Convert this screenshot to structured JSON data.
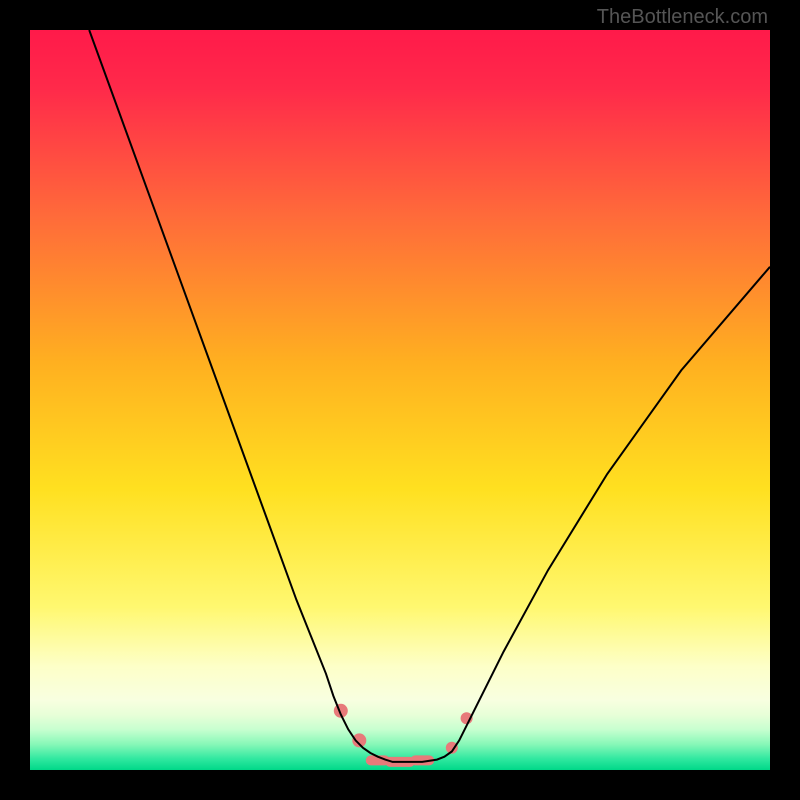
{
  "watermark": "TheBottleneck.com",
  "chart_data": {
    "type": "line",
    "title": "",
    "xlabel": "",
    "ylabel": "",
    "xlim": [
      0,
      100
    ],
    "ylim": [
      0,
      100
    ],
    "background_gradient": {
      "stops": [
        {
          "offset": 0.0,
          "color": "#ff1a4a"
        },
        {
          "offset": 0.08,
          "color": "#ff2a4a"
        },
        {
          "offset": 0.25,
          "color": "#ff6a3a"
        },
        {
          "offset": 0.45,
          "color": "#ffb020"
        },
        {
          "offset": 0.62,
          "color": "#ffe020"
        },
        {
          "offset": 0.78,
          "color": "#fff870"
        },
        {
          "offset": 0.86,
          "color": "#fdffc8"
        },
        {
          "offset": 0.905,
          "color": "#f8ffe0"
        },
        {
          "offset": 0.925,
          "color": "#e8ffd8"
        },
        {
          "offset": 0.945,
          "color": "#c8ffd0"
        },
        {
          "offset": 0.965,
          "color": "#88f8b8"
        },
        {
          "offset": 0.985,
          "color": "#30e8a0"
        },
        {
          "offset": 1.0,
          "color": "#00d888"
        }
      ]
    },
    "series": [
      {
        "name": "bottleneck-curve",
        "color": "#000000",
        "x": [
          8,
          12,
          16,
          20,
          24,
          28,
          32,
          36,
          38,
          40,
          41,
          42,
          43,
          44,
          45,
          46,
          47,
          48,
          49,
          51,
          53,
          55,
          56,
          57,
          58,
          60,
          64,
          70,
          78,
          88,
          100
        ],
        "y": [
          100,
          89,
          78,
          67,
          56,
          45,
          34,
          23,
          18,
          13,
          10,
          7.5,
          5.5,
          4,
          3,
          2.3,
          1.8,
          1.4,
          1.1,
          1.1,
          1.1,
          1.4,
          1.8,
          2.5,
          4,
          8,
          16,
          27,
          40,
          54,
          68
        ]
      }
    ],
    "markers": [
      {
        "name": "dot-left-upper",
        "x": 42,
        "y": 8,
        "color": "#e77a7a",
        "r": 7
      },
      {
        "name": "dot-left-lower",
        "x": 44.5,
        "y": 4,
        "color": "#e77a7a",
        "r": 7
      },
      {
        "name": "dash-bottom-1",
        "x": 47,
        "y": 1.3,
        "color": "#e77a7a",
        "len": 8
      },
      {
        "name": "dash-bottom-2",
        "x": 50,
        "y": 1.1,
        "color": "#e77a7a",
        "len": 10
      },
      {
        "name": "dash-bottom-3",
        "x": 53,
        "y": 1.3,
        "color": "#e77a7a",
        "len": 8
      },
      {
        "name": "dot-right-lower",
        "x": 57,
        "y": 3,
        "color": "#e77a7a",
        "r": 6
      },
      {
        "name": "dot-right-upper",
        "x": 59,
        "y": 7,
        "color": "#e77a7a",
        "r": 6
      }
    ]
  }
}
